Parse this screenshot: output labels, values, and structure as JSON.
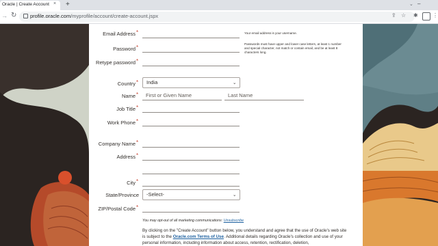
{
  "browser": {
    "tab_title": "Oracle | Create Account",
    "tab_close": "×",
    "new_tab": "+",
    "url_host": "profile.oracle.com",
    "url_path": "/myprofile/account/create-account.jspx",
    "icons": [
      "share-icon",
      "star-icon",
      "extensions-icon",
      "reading-list-icon",
      "profile-icon",
      "menu-icon"
    ]
  },
  "form": {
    "required_mark": "*",
    "labels": {
      "email": "Email Address",
      "password": "Password",
      "retype_password": "Retype password",
      "country": "Country",
      "name": "Name",
      "job_title": "Job Title",
      "work_phone": "Work Phone",
      "company_name": "Company Name",
      "address": "Address",
      "city": "City",
      "state": "State/Province",
      "zip": "ZIP/Postal Code"
    },
    "country_value": "India",
    "first_name_placeholder": "First or Given Name",
    "last_name_placeholder": "Last Name",
    "state_value": "-Select-",
    "email_hint": "Your email address is your username.",
    "password_hint": "Passwords must have upper and lower case letters, at least 1 number and special character, not match or contain email, and be at least 8 characters long.",
    "optout_text": "You may opt-out of all marketing communications:",
    "unsubscribe_link": "Unsubscribe",
    "consent_prefix": "By clicking on the \"Create Account\" button below, you understand and agree that the use of Oracle's web site is subject to the",
    "terms_link": "Oracle.com Terms of Use",
    "consent_suffix": ". Additional details regarding Oracle's collection and use of your personal information, including information about access, retention, rectification, deletion,"
  },
  "colors": {
    "required": "#c74634",
    "link": "#1a5e9e",
    "bg_teal": "#5f7f86",
    "bg_orange": "#d9782d",
    "bg_dark": "#2b2421"
  }
}
